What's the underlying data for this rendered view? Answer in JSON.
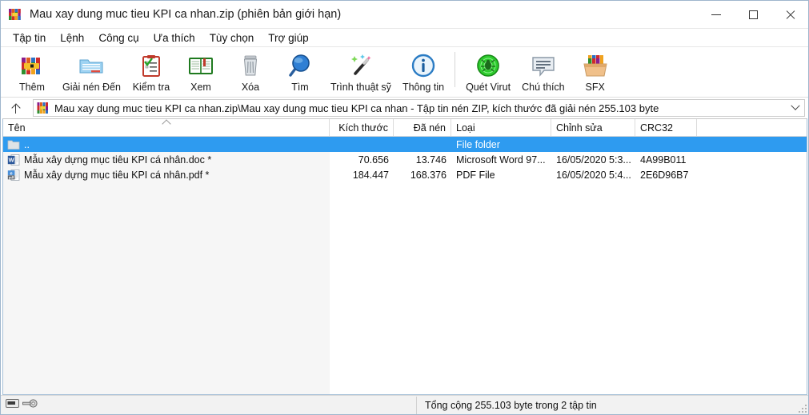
{
  "window": {
    "title": "Mau xay dung muc tieu KPI ca nhan.zip (phiên bản giới hạn)",
    "app_icon": "winrar-books-icon",
    "minimize_label": "Thu nhỏ",
    "maximize_label": "Phóng to",
    "close_label": "Đóng"
  },
  "menubar": {
    "items": [
      {
        "label": "Tập tin",
        "name": "menu-file"
      },
      {
        "label": "Lệnh",
        "name": "menu-commands"
      },
      {
        "label": "Công cụ",
        "name": "menu-tools"
      },
      {
        "label": "Ưa thích",
        "name": "menu-favorites"
      },
      {
        "label": "Tùy chọn",
        "name": "menu-options"
      },
      {
        "label": "Trợ giúp",
        "name": "menu-help"
      }
    ]
  },
  "toolbar": {
    "buttons": [
      {
        "label": "Thêm",
        "icon": "add-archive-icon",
        "name": "toolbar-add"
      },
      {
        "label": "Giải nén Đến",
        "icon": "extract-to-folder-icon",
        "name": "toolbar-extract-to"
      },
      {
        "label": "Kiểm tra",
        "icon": "test-clipboard-icon",
        "name": "toolbar-test"
      },
      {
        "label": "Xem",
        "icon": "view-book-icon",
        "name": "toolbar-view"
      },
      {
        "label": "Xóa",
        "icon": "delete-trash-icon",
        "name": "toolbar-delete"
      },
      {
        "label": "Tìm",
        "icon": "find-magnifier-icon",
        "name": "toolbar-find"
      },
      {
        "label": "Trình thuật sỹ",
        "icon": "wizard-wand-icon",
        "name": "toolbar-wizard"
      },
      {
        "label": "Thông tin",
        "icon": "info-circle-icon",
        "name": "toolbar-info"
      },
      {
        "label": "Quét Virut",
        "icon": "virus-scan-icon",
        "name": "toolbar-virus-scan"
      },
      {
        "label": "Chú thích",
        "icon": "comment-bubble-icon",
        "name": "toolbar-comment"
      },
      {
        "label": "SFX",
        "icon": "sfx-box-icon",
        "name": "toolbar-sfx"
      }
    ]
  },
  "addressbar": {
    "up_label": "Lên một cấp",
    "archive_icon": "winrar-archive-icon",
    "path": "Mau xay dung muc tieu KPI ca nhan.zip\\Mau xay dung muc tieu KPI ca nhan - Tập tin nén ZIP, kích thước đã giải nén 255.103 byte",
    "dropdown_icon": "chevron-down-icon"
  },
  "filelist": {
    "columns": [
      {
        "label": "Tên",
        "name": "column-name",
        "sorted": true
      },
      {
        "label": "Kích thước",
        "name": "column-size"
      },
      {
        "label": "Đã nén",
        "name": "column-packed"
      },
      {
        "label": "Loại",
        "name": "column-type"
      },
      {
        "label": "Chỉnh sửa",
        "name": "column-modified"
      },
      {
        "label": "CRC32",
        "name": "column-crc32"
      }
    ],
    "rows": [
      {
        "name": "..",
        "icon": "parent-folder-icon",
        "size": "",
        "packed": "",
        "type": "File folder",
        "modified": "",
        "crc32": "",
        "selected": true
      },
      {
        "name": "Mẫu xây dựng mục tiêu KPI cá nhân.doc *",
        "icon": "word-document-icon",
        "size": "70.656",
        "packed": "13.746",
        "type": "Microsoft Word 97...",
        "modified": "16/05/2020 5:3...",
        "crc32": "4A99B011",
        "selected": false
      },
      {
        "name": "Mẫu xây dựng mục tiêu KPI cá nhân.pdf *",
        "icon": "pdf-document-icon",
        "size": "184.447",
        "packed": "168.376",
        "type": "PDF File",
        "modified": "16/05/2020 5:4...",
        "crc32": "2E6D96B7",
        "selected": false
      }
    ]
  },
  "statusbar": {
    "drive_icon": "drive-icon",
    "key_icon": "key-icon",
    "total_text": "Tổng cộng 255.103 byte trong 2 tập tin"
  },
  "colors": {
    "selection": "#2e9bf0",
    "window_border": "#9fb6cd",
    "status_bg": "#f2f2f2"
  }
}
